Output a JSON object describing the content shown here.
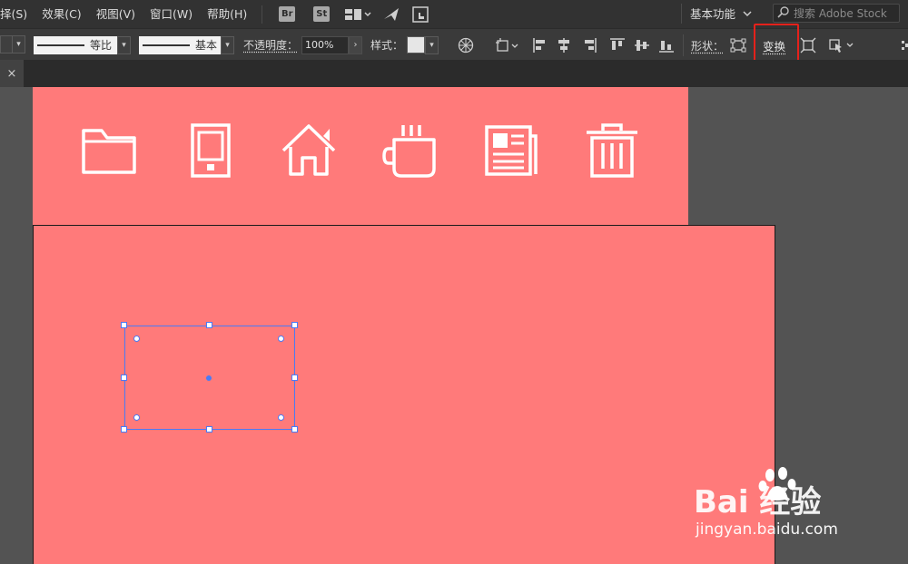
{
  "menu": {
    "items": [
      {
        "label": "择(S)"
      },
      {
        "label": "效果(C)"
      },
      {
        "label": "视图(V)"
      },
      {
        "label": "窗口(W)"
      },
      {
        "label": "帮助(H)"
      }
    ],
    "bridge_badge": "Br",
    "stock_badge": "St",
    "workspace_label": "基本功能",
    "search_placeholder": "搜索 Adobe Stock"
  },
  "control_bar": {
    "stroke_profile_label": "等比",
    "brush_label": "基本",
    "opacity_label": "不透明度：",
    "opacity_value": "100%",
    "style_label": "样式：",
    "shape_label": "形状：",
    "transform_label": "变换"
  },
  "tabs": {
    "close_glyph": "×"
  },
  "artboard": {
    "background_color": "#ff7a7a",
    "icons": [
      "folder-icon",
      "tablet-icon",
      "home-icon",
      "coffee-cup-icon",
      "newspaper-icon",
      "trash-icon"
    ]
  },
  "watermark": {
    "brand": "Bai 经验",
    "url": "jingyan.baidu.com"
  },
  "colors": {
    "highlight": "#e5211b",
    "selection": "#4a7af5"
  }
}
